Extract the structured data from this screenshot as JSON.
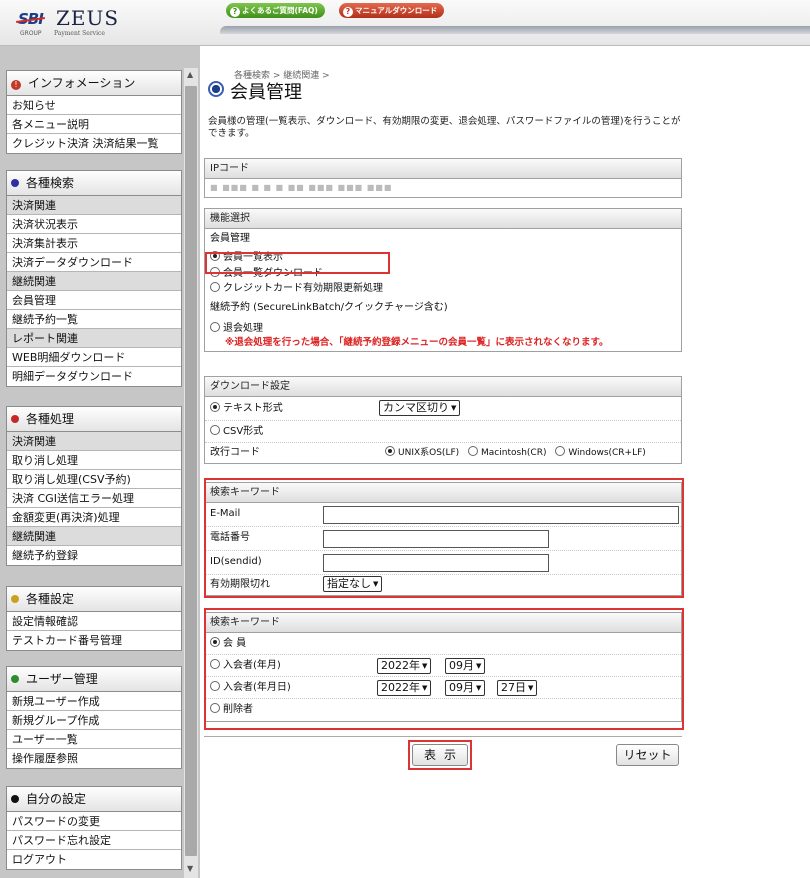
{
  "header": {
    "logo_sbi": "SBI",
    "logo_zeus": "ZEUS",
    "logo_group": "GROUP",
    "logo_service": "Payment Service",
    "faq_label": "よくあるご質問(FAQ)",
    "manual_label": "マニュアルダウンロード"
  },
  "sidebar": {
    "info": {
      "title": "インフォメーション",
      "items": [
        "お知らせ",
        "各メニュー説明",
        "クレジット決済 決済結果一覧"
      ]
    },
    "search": {
      "title": "各種検索",
      "items": [
        "決済関連",
        "決済状況表示",
        "決済集計表示",
        "決済データダウンロード",
        "継続関連",
        "会員管理",
        "継続予約一覧",
        "レポート関連",
        "WEB明細ダウンロード",
        "明細データダウンロード"
      ]
    },
    "process": {
      "title": "各種処理",
      "items": [
        "決済関連",
        "取り消し処理",
        "取り消し処理(CSV予約)",
        "決済 CGI送信エラー処理",
        "金額変更(再決済)処理",
        "継続関連",
        "継続予約登録"
      ]
    },
    "settings": {
      "title": "各種設定",
      "items": [
        "設定情報確認",
        "テストカード番号管理"
      ]
    },
    "users": {
      "title": "ユーザー管理",
      "items": [
        "新規ユーザー作成",
        "新規グループ作成",
        "ユーザー一覧",
        "操作履歴参照"
      ]
    },
    "mine": {
      "title": "自分の設定",
      "items": [
        "パスワードの変更",
        "パスワード忘れ設定",
        "ログアウト"
      ]
    },
    "colors": {
      "info": "#c0392b",
      "search": "#2f2f9f",
      "process": "#c62828",
      "settings": "#c9a21d",
      "users": "#2e8b2e",
      "mine": "#111111"
    }
  },
  "main": {
    "breadcrumb": "各種検索 > 継続関連 >",
    "title": "会員管理",
    "description": "会員様の管理(一覧表示、ダウンロード、有効期限の変更、退会処理、パスワードファイルの管理)を行うことができます。",
    "ip": {
      "label": "IPコード",
      "value": "■ ■■■ ■  ■ ■ ■■ ■■■ ■■■  ■■■"
    },
    "function": {
      "label": "機能選択",
      "group1": "会員管理",
      "options": [
        "会員一覧表示",
        "会員一覧ダウンロード",
        "クレジットカード有効期限更新処理"
      ],
      "group2": "継続予約 (SecureLinkBatch/クイックチャージ含む)",
      "withdraw": "退会処理",
      "warning": "※退会処理を行った場合、「継続予約登録メニューの会員一覧」に表示されなくなります。"
    },
    "download": {
      "label": "ダウンロード設定",
      "text_format": "テキスト形式",
      "delimiter": "カンマ区切り",
      "csv_format": "CSV形式",
      "newline_label": "改行コード",
      "newline_options": [
        "UNIX系OS(LF)",
        "Macintosh(CR)",
        "Windows(CR+LF)"
      ]
    },
    "keyword1": {
      "label": "検索キーワード",
      "email": "E-Mail",
      "phone": "電話番号",
      "sendid": "ID(sendid)",
      "expiry": "有効期限切れ",
      "expiry_value": "指定なし"
    },
    "keyword2": {
      "label": "検索キーワード",
      "member": "会 員",
      "join_month": "入会者(年月)",
      "join_day": "入会者(年月日)",
      "deleted": "削除者",
      "year": "2022年",
      "month": "09月",
      "day": "27日"
    },
    "show_button": "表示",
    "reset_button": "リセット"
  }
}
